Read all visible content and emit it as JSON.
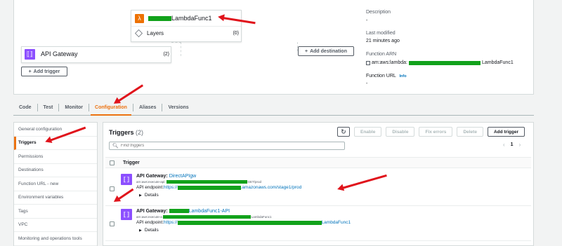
{
  "overview": {
    "function_name_suffix": "LambdaFunc1",
    "layers_label": "Layers",
    "layers_count": "(0)",
    "gateway_label": "API Gateway",
    "gateway_count": "(2)",
    "add_trigger": "Add trigger",
    "add_destination": "Add destination",
    "description_label": "Description",
    "description_value": "-",
    "last_modified_label": "Last modified",
    "last_modified_value": "21 minutes ago",
    "arn_label": "Function ARN",
    "arn_prefix": "am:aws:lambda:",
    "arn_suffix": "LambdaFunc1",
    "url_label": "Function URL",
    "url_info": "Info",
    "url_value": "-"
  },
  "tabs": [
    {
      "label": "Code"
    },
    {
      "label": "Test"
    },
    {
      "label": "Monitor"
    },
    {
      "label": "Configuration"
    },
    {
      "label": "Aliases"
    },
    {
      "label": "Versions"
    }
  ],
  "active_tab": "Configuration",
  "sidebar": {
    "items": [
      {
        "label": "General configuration"
      },
      {
        "label": "Triggers"
      },
      {
        "label": "Permissions"
      },
      {
        "label": "Destinations"
      },
      {
        "label": "Function URL - new"
      },
      {
        "label": "Environment variables"
      },
      {
        "label": "Tags"
      },
      {
        "label": "VPC"
      },
      {
        "label": "Monitoring and operations tools"
      }
    ],
    "active": "Triggers"
  },
  "triggers": {
    "title": "Triggers",
    "count": "(2)",
    "search_placeholder": "Find triggers",
    "buttons": {
      "enable": "Enable",
      "disable": "Disable",
      "fix_errors": "Fix errors",
      "delete": "Delete",
      "add_trigger": "Add trigger"
    },
    "page": "1",
    "column": "Trigger",
    "rows": [
      {
        "prefix": "API Gateway: ",
        "name": "DirectAPIgw",
        "arn_prefix": "arn:aws:execute-api:",
        "arn_suffix": "GET/prod",
        "endpoint_label": "API endpoint: ",
        "endpoint_prefix": "https://",
        "endpoint_suffix": ".amazonaws.com/stage1/prod",
        "details": "Details"
      },
      {
        "prefix": "API Gateway: ",
        "name_suffix": "LambdaFunc1-API",
        "arn_prefix": "arn:aws:execute-a",
        "arn_suffix": "LambdaFunc1",
        "endpoint_label": "API endpoint: ",
        "endpoint_prefix": "https://",
        "endpoint_suffix": "LambdaFunc1",
        "details": "Details"
      }
    ]
  }
}
